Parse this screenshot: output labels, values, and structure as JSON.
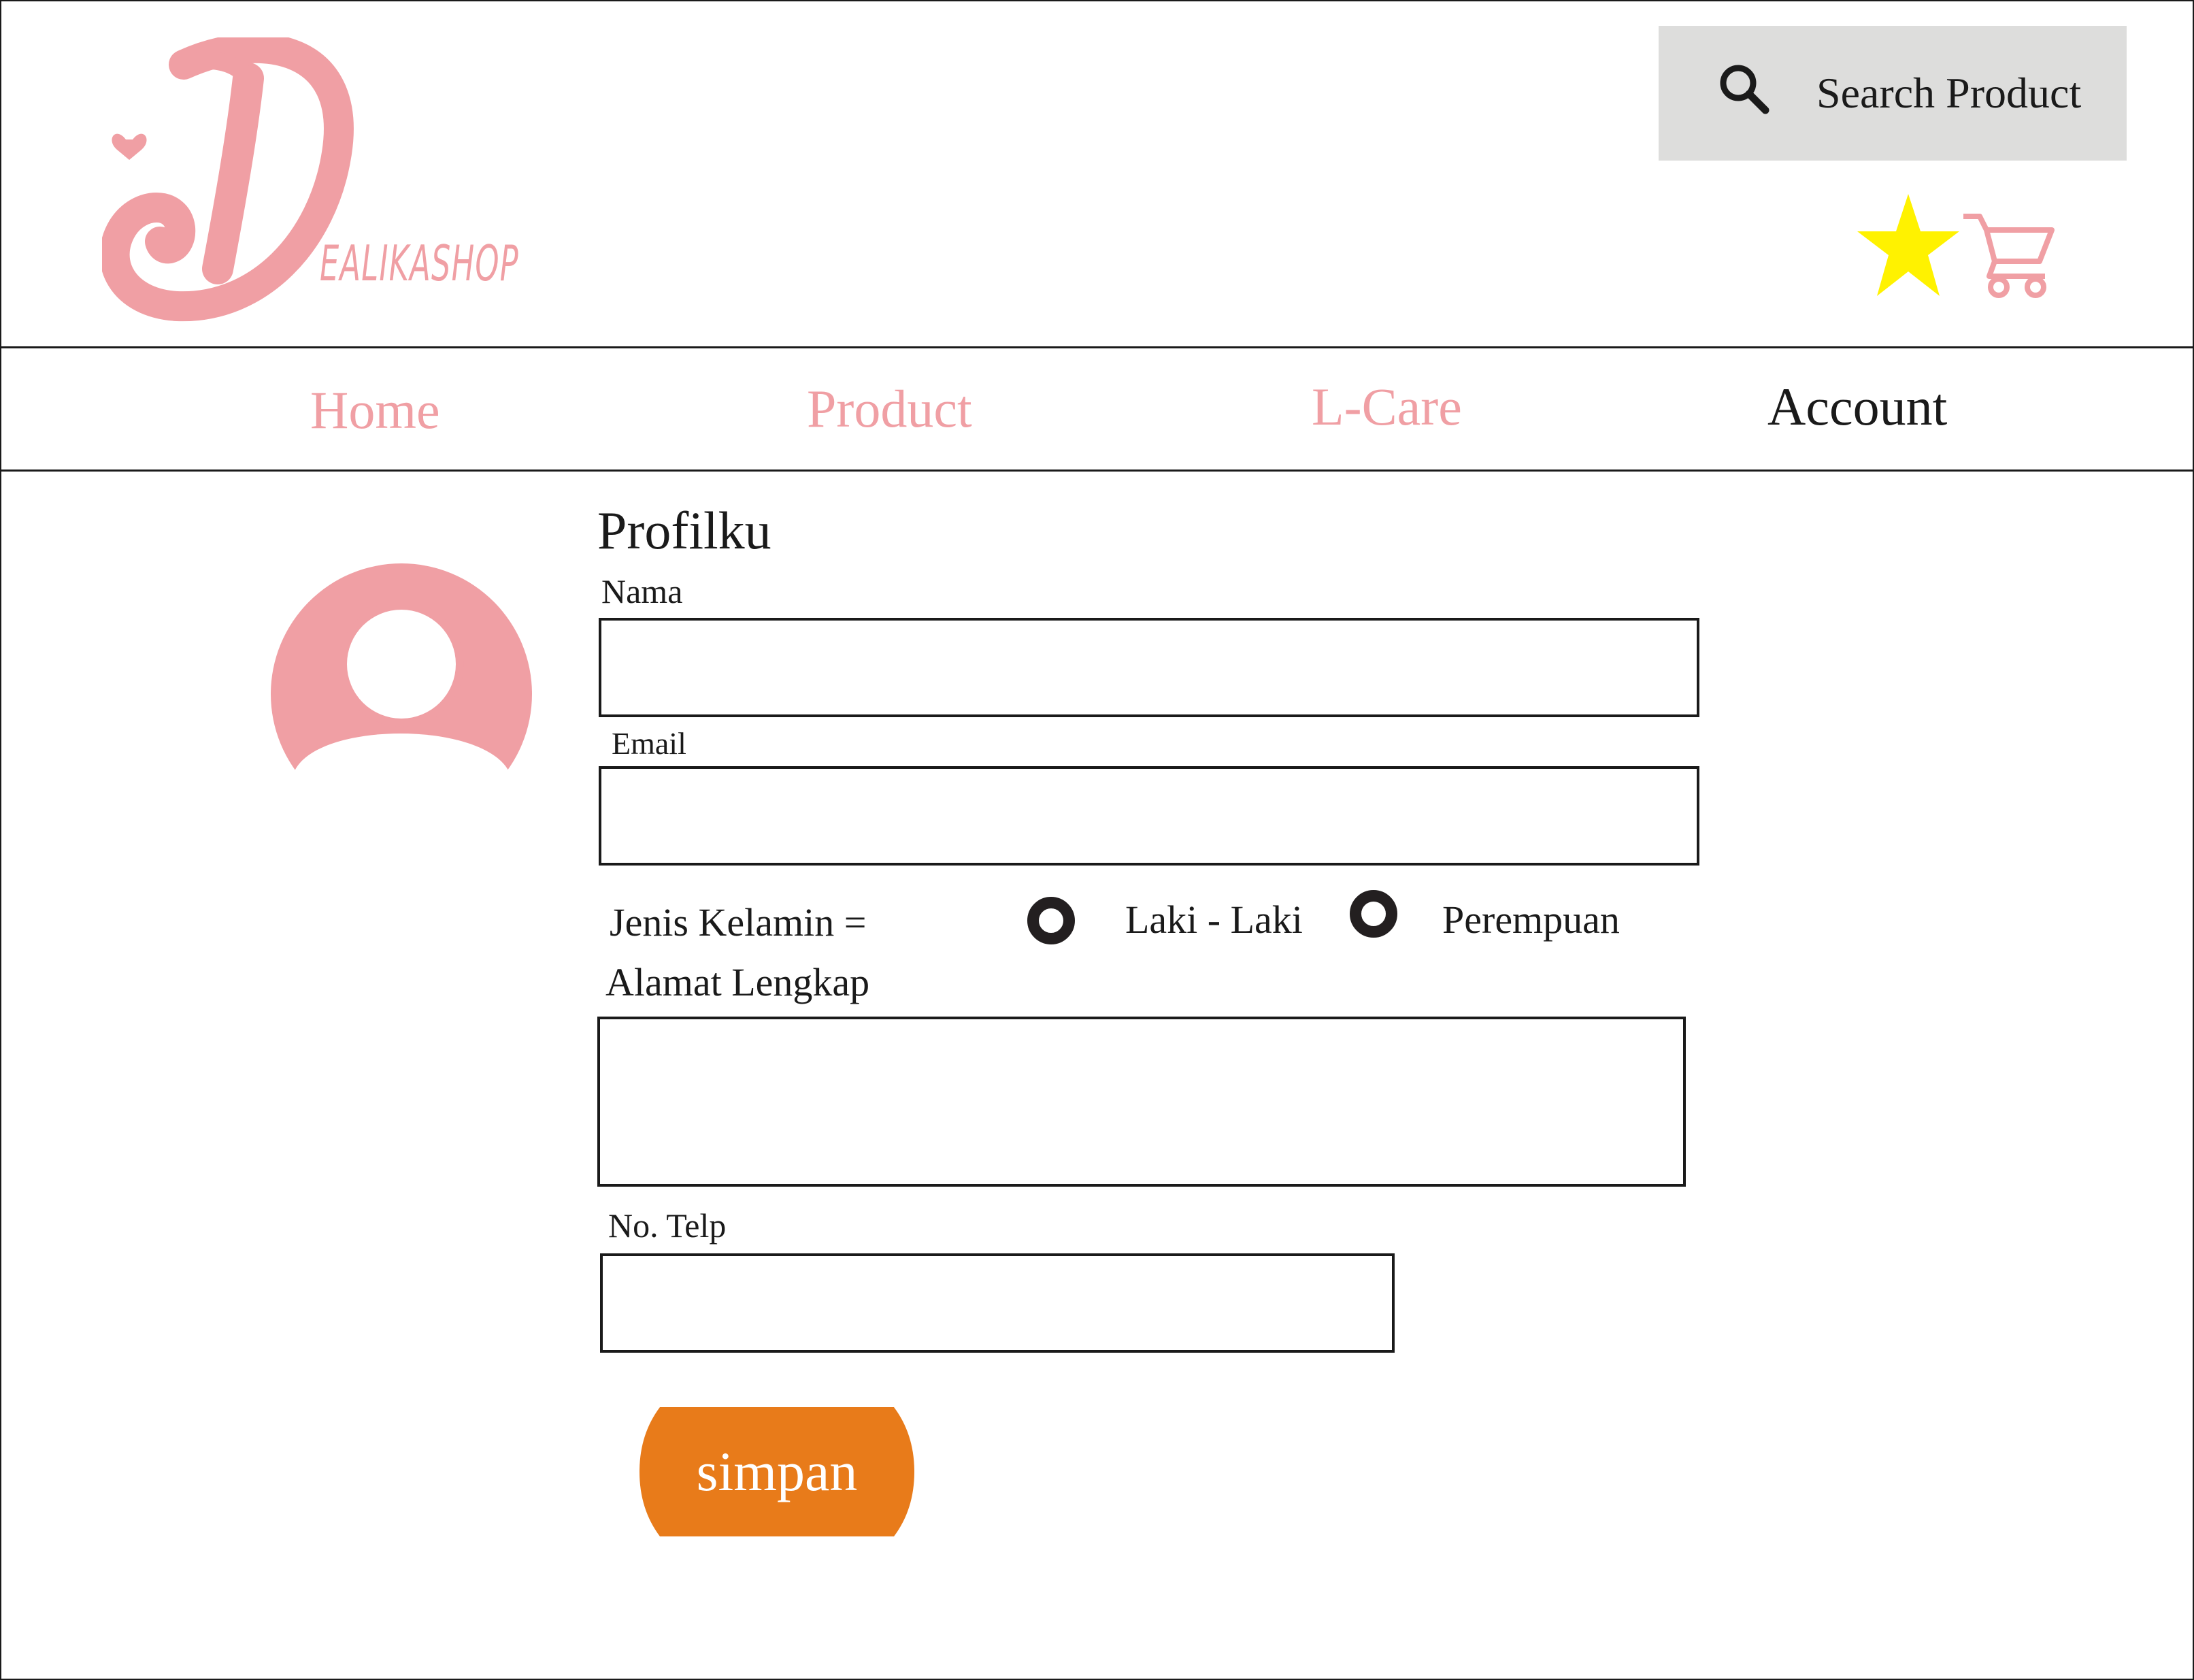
{
  "brand": {
    "logo_letter": "D",
    "wordmark": "EALIKASHOP"
  },
  "header": {
    "search": {
      "placeholder": "Search Product",
      "icon": "search-icon"
    },
    "wishlist_icon": "star-icon",
    "cart_icon": "cart-icon"
  },
  "nav": {
    "items": [
      {
        "label": "Home",
        "active": false
      },
      {
        "label": "Product",
        "active": false
      },
      {
        "label": "L-Care",
        "active": false
      },
      {
        "label": "Account",
        "active": true
      }
    ]
  },
  "profile": {
    "title": "Profilku",
    "avatar_icon": "user-avatar-icon",
    "fields": {
      "name": {
        "label": "Nama",
        "value": ""
      },
      "email": {
        "label": "Email",
        "value": ""
      },
      "gender": {
        "label": "Jenis Kelamin =",
        "options": [
          "Laki - Laki",
          "Perempuan"
        ]
      },
      "address": {
        "label": "Alamat Lengkap",
        "value": ""
      },
      "phone": {
        "label": "No. Telp",
        "value": ""
      }
    },
    "save_label": "simpan"
  },
  "colors": {
    "brand_pink": "#f09fa4",
    "search_bg": "#dddddc",
    "star_yellow": "#fff200",
    "save_orange": "#e87b1a",
    "text_dark": "#1a1a1a"
  }
}
